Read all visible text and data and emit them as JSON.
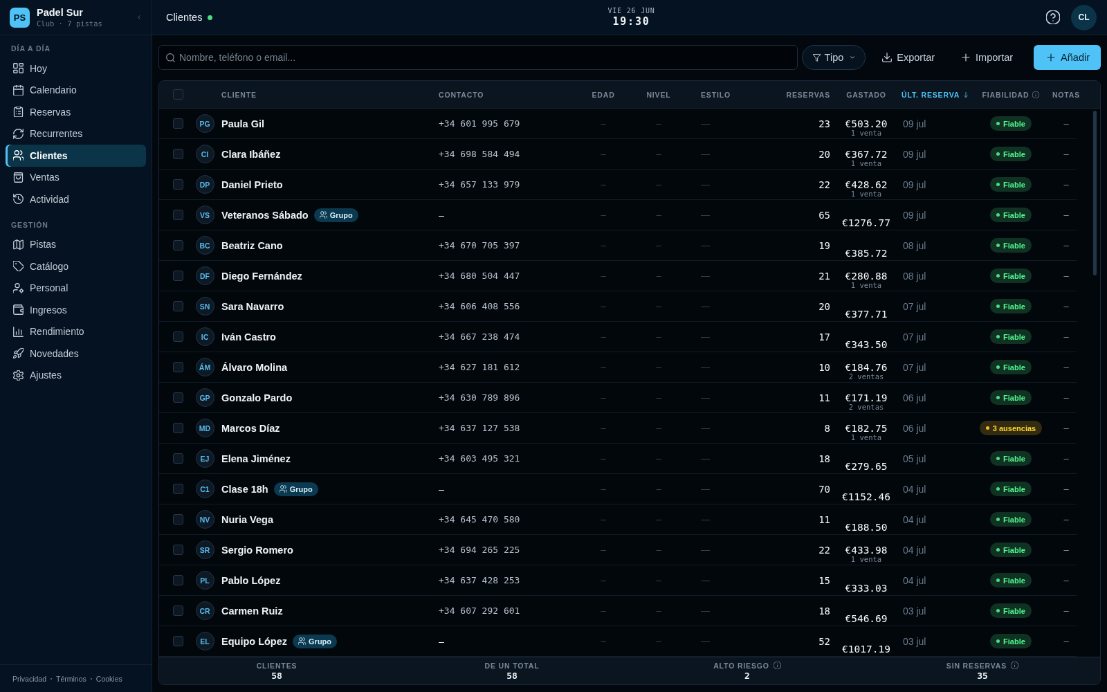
{
  "sidebar": {
    "logo": "PS",
    "club_name": "Padel Sur",
    "club_info": "Club · 7 pistas",
    "sections": [
      {
        "heading": "DÍA A DÍA",
        "items": [
          {
            "label": "Hoy",
            "selected": false
          },
          {
            "label": "Calendario",
            "selected": false
          },
          {
            "label": "Reservas",
            "selected": false
          },
          {
            "label": "Recurrentes",
            "selected": false
          },
          {
            "label": "Clientes",
            "selected": true
          },
          {
            "label": "Ventas",
            "selected": false
          },
          {
            "label": "Actividad",
            "selected": false
          }
        ]
      },
      {
        "heading": "GESTIÓN",
        "items": [
          {
            "label": "Pistas",
            "selected": false
          },
          {
            "label": "Catálogo",
            "selected": false
          },
          {
            "label": "Personal",
            "selected": false
          },
          {
            "label": "Ingresos",
            "selected": false
          },
          {
            "label": "Rendimiento",
            "selected": false
          },
          {
            "label": "Novedades",
            "selected": false
          },
          {
            "label": "Ajustes",
            "selected": false
          }
        ]
      }
    ],
    "footer_links": [
      "Privacidad",
      "Términos",
      "Cookies"
    ]
  },
  "topbar": {
    "title": "Clientes",
    "date": "VIE 26 JUN",
    "time": "19:30",
    "avatar": "CL"
  },
  "toolbar": {
    "search": {
      "placeholder": "Nombre, teléfono o email..."
    },
    "buttons": [
      {
        "label": "Tipo",
        "kind": "filter"
      },
      {
        "label": "Exportar",
        "kind": "export"
      },
      {
        "label": "Importar",
        "kind": "import"
      },
      {
        "label": "Añadir",
        "kind": "add"
      }
    ]
  },
  "table": {
    "select_all": {
      "checked": false
    },
    "columns": [
      {
        "label": "CLIENTE",
        "sorted": false,
        "info": false
      },
      {
        "label": "CONTACTO",
        "sorted": false,
        "info": false
      },
      {
        "label": "EDAD",
        "sorted": false,
        "info": false
      },
      {
        "label": "NIVEL",
        "sorted": false,
        "info": false
      },
      {
        "label": "ESTILO",
        "sorted": false,
        "info": false
      },
      {
        "label": "RESERVAS",
        "sorted": false,
        "info": false
      },
      {
        "label": "GASTADO",
        "sorted": false,
        "info": false
      },
      {
        "label": "ÚLT. RESERVA",
        "sorted": true,
        "info": false
      },
      {
        "label": "FIABILIDAD",
        "sorted": false,
        "info": true
      },
      {
        "label": "NOTAS",
        "sorted": false,
        "info": false
      }
    ],
    "rows": [
      {
        "selected": false,
        "initials": "PG",
        "name": "Paula Gil",
        "contact": "+34 601 995 679",
        "age": "–",
        "player_level": "–",
        "style": "—",
        "bookings": "23",
        "spent": "€503.20",
        "spent_note": "1 venta",
        "last_booking": "09 jul",
        "reliability": {
          "label": "Fiable",
          "color": "#4ade80"
        },
        "notes": "–"
      },
      {
        "selected": false,
        "initials": "CI",
        "name": "Clara Ibáñez",
        "contact": "+34 698 584 494",
        "age": "–",
        "player_level": "–",
        "style": "—",
        "bookings": "20",
        "spent": "€367.72",
        "spent_note": "1 venta",
        "last_booking": "09 jul",
        "reliability": {
          "label": "Fiable",
          "color": "#4ade80"
        },
        "notes": "–"
      },
      {
        "selected": false,
        "initials": "DP",
        "name": "Daniel Prieto",
        "contact": "+34 657 133 979",
        "age": "–",
        "player_level": "–",
        "style": "—",
        "bookings": "22",
        "spent": "€428.62",
        "spent_note": "1 venta",
        "last_booking": "09 jul",
        "reliability": {
          "label": "Fiable",
          "color": "#4ade80"
        },
        "notes": "–"
      },
      {
        "selected": false,
        "initials": "VS",
        "name": "Veteranos Sábado",
        "tag": "Grupo",
        "contact": "–",
        "age": "–",
        "player_level": "–",
        "style": "—",
        "bookings": "65",
        "spent": "€1276.77",
        "last_booking": "09 jul",
        "reliability": {
          "label": "Fiable",
          "color": "#4ade80"
        },
        "notes": "–"
      },
      {
        "selected": false,
        "initials": "BC",
        "name": "Beatriz Cano",
        "contact": "+34 670 705 397",
        "age": "–",
        "player_level": "–",
        "style": "—",
        "bookings": "19",
        "spent": "€385.72",
        "last_booking": "08 jul",
        "reliability": {
          "label": "Fiable",
          "color": "#4ade80"
        },
        "notes": "–"
      },
      {
        "selected": false,
        "initials": "DF",
        "name": "Diego Fernández",
        "contact": "+34 680 504 447",
        "age": "–",
        "player_level": "–",
        "style": "—",
        "bookings": "21",
        "spent": "€280.88",
        "spent_note": "1 venta",
        "last_booking": "08 jul",
        "reliability": {
          "label": "Fiable",
          "color": "#4ade80"
        },
        "notes": "–"
      },
      {
        "selected": false,
        "initials": "SN",
        "name": "Sara Navarro",
        "contact": "+34 606 408 556",
        "age": "–",
        "player_level": "–",
        "style": "—",
        "bookings": "20",
        "spent": "€377.71",
        "last_booking": "07 jul",
        "reliability": {
          "label": "Fiable",
          "color": "#4ade80"
        },
        "notes": "–"
      },
      {
        "selected": false,
        "initials": "IC",
        "name": "Iván Castro",
        "contact": "+34 667 238 474",
        "age": "–",
        "player_level": "–",
        "style": "—",
        "bookings": "17",
        "spent": "€343.50",
        "last_booking": "07 jul",
        "reliability": {
          "label": "Fiable",
          "color": "#4ade80"
        },
        "notes": "–"
      },
      {
        "selected": false,
        "initials": "ÁM",
        "name": "Álvaro Molina",
        "contact": "+34 627 181 612",
        "age": "–",
        "player_level": "–",
        "style": "—",
        "bookings": "10",
        "spent": "€184.76",
        "spent_note": "2 ventas",
        "last_booking": "07 jul",
        "reliability": {
          "label": "Fiable",
          "color": "#4ade80"
        },
        "notes": "–"
      },
      {
        "selected": false,
        "initials": "GP",
        "name": "Gonzalo Pardo",
        "contact": "+34 630 789 896",
        "age": "–",
        "player_level": "–",
        "style": "—",
        "bookings": "11",
        "spent": "€171.19",
        "spent_note": "2 ventas",
        "last_booking": "06 jul",
        "reliability": {
          "label": "Fiable",
          "color": "#4ade80"
        },
        "notes": "–"
      },
      {
        "selected": false,
        "initials": "MD",
        "name": "Marcos Díaz",
        "contact": "+34 637 127 538",
        "age": "–",
        "player_level": "–",
        "style": "—",
        "bookings": "8",
        "spent": "€182.75",
        "spent_note": "1 venta",
        "last_booking": "06 jul",
        "reliability": {
          "label": "3 ausencias",
          "color": "#fbbf24"
        },
        "notes": "–"
      },
      {
        "selected": false,
        "initials": "EJ",
        "name": "Elena Jiménez",
        "contact": "+34 603 495 321",
        "age": "–",
        "player_level": "–",
        "style": "—",
        "bookings": "18",
        "spent": "€279.65",
        "last_booking": "05 jul",
        "reliability": {
          "label": "Fiable",
          "color": "#4ade80"
        },
        "notes": "–"
      },
      {
        "selected": false,
        "initials": "C1",
        "name": "Clase 18h",
        "tag": "Grupo",
        "contact": "–",
        "age": "–",
        "player_level": "–",
        "style": "—",
        "bookings": "70",
        "spent": "€1152.46",
        "last_booking": "04 jul",
        "reliability": {
          "label": "Fiable",
          "color": "#4ade80"
        },
        "notes": "–"
      },
      {
        "selected": false,
        "initials": "NV",
        "name": "Nuria Vega",
        "contact": "+34 645 470 580",
        "age": "–",
        "player_level": "–",
        "style": "—",
        "bookings": "11",
        "spent": "€188.50",
        "last_booking": "04 jul",
        "reliability": {
          "label": "Fiable",
          "color": "#4ade80"
        },
        "notes": "–"
      },
      {
        "selected": false,
        "initials": "SR",
        "name": "Sergio Romero",
        "contact": "+34 694 265 225",
        "age": "–",
        "player_level": "–",
        "style": "—",
        "bookings": "22",
        "spent": "€433.98",
        "spent_note": "1 venta",
        "last_booking": "04 jul",
        "reliability": {
          "label": "Fiable",
          "color": "#4ade80"
        },
        "notes": "–"
      },
      {
        "selected": false,
        "initials": "PL",
        "name": "Pablo López",
        "contact": "+34 637 428 253",
        "age": "–",
        "player_level": "–",
        "style": "—",
        "bookings": "15",
        "spent": "€333.03",
        "last_booking": "04 jul",
        "reliability": {
          "label": "Fiable",
          "color": "#4ade80"
        },
        "notes": "–"
      },
      {
        "selected": false,
        "initials": "CR",
        "name": "Carmen Ruiz",
        "contact": "+34 607 292 601",
        "age": "–",
        "player_level": "–",
        "style": "—",
        "bookings": "18",
        "spent": "€546.69",
        "last_booking": "03 jul",
        "reliability": {
          "label": "Fiable",
          "color": "#4ade80"
        },
        "notes": "–"
      },
      {
        "selected": false,
        "initials": "EL",
        "name": "Equipo López",
        "tag": "Grupo",
        "contact": "–",
        "age": "–",
        "player_level": "–",
        "style": "—",
        "bookings": "52",
        "spent": "€1017.19",
        "last_booking": "03 jul",
        "reliability": {
          "label": "Fiable",
          "color": "#4ade80"
        },
        "notes": "–"
      }
    ],
    "summary": [
      {
        "label": "CLIENTES",
        "value": "58",
        "info": false
      },
      {
        "label": "DE UN TOTAL",
        "value": "58",
        "info": false
      },
      {
        "label": "ALTO RIESGO",
        "value": "2",
        "info": true
      },
      {
        "label": "SIN RESERVAS",
        "value": "35",
        "info": true
      }
    ]
  }
}
